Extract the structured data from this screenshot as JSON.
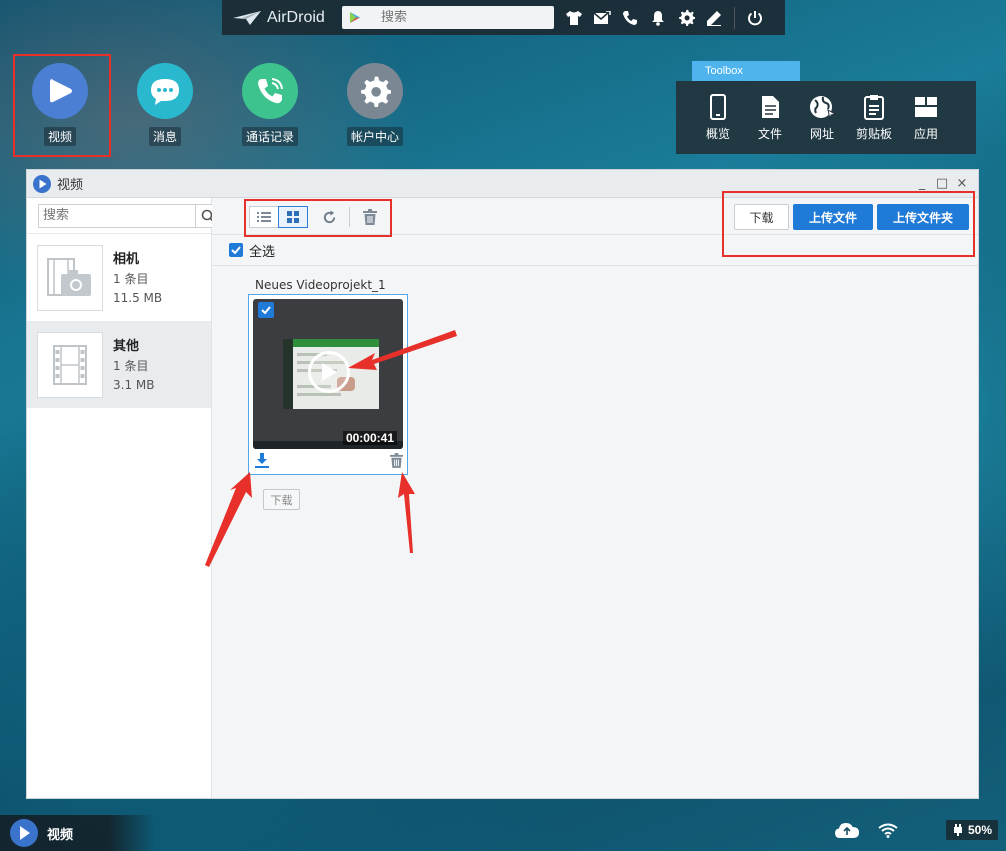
{
  "topbar": {
    "brand": "AirDroid",
    "search_placeholder": "搜索",
    "icons": [
      "tshirt-icon",
      "mail-icon",
      "phone-icon",
      "bell-icon",
      "gear-icon",
      "pen-icon",
      "power-icon"
    ]
  },
  "desktop": {
    "icons": [
      {
        "label": "视频",
        "icon": "video-play-icon",
        "color": "#4a7fd4"
      },
      {
        "label": "消息",
        "icon": "message-icon",
        "color": "#2ab8cf"
      },
      {
        "label": "通话记录",
        "icon": "call-log-icon",
        "color": "#3dc48e"
      },
      {
        "label": "帐户中心",
        "icon": "settings-icon",
        "color": "#7b8894"
      }
    ]
  },
  "toolbox": {
    "title": "Toolbox",
    "items": [
      {
        "label": "概览",
        "icon": "phone-device-icon"
      },
      {
        "label": "文件",
        "icon": "file-icon"
      },
      {
        "label": "网址",
        "icon": "globe-icon"
      },
      {
        "label": "剪贴板",
        "icon": "clipboard-icon"
      },
      {
        "label": "应用",
        "icon": "apps-icon"
      }
    ]
  },
  "window": {
    "title": "视频",
    "controls": [
      "_",
      "□",
      "×"
    ],
    "search_placeholder": "搜索",
    "albums": [
      {
        "name": "相机",
        "count": "1 条目",
        "size": "11.5 MB"
      },
      {
        "name": "其他",
        "count": "1 条目",
        "size": "3.1 MB"
      }
    ],
    "toolbar": {
      "download": "下载",
      "upload_file": "上传文件",
      "upload_folder": "上传文件夹"
    },
    "select_all": "全选",
    "group_title": "Neues Videoprojekt_1",
    "video": {
      "duration": "00:00:41"
    },
    "download_small": "下载"
  },
  "dock": {
    "app_label": "视频",
    "battery": "50%"
  },
  "colors": {
    "accent": "#1f7ad8",
    "annotation": "#e8302a"
  }
}
